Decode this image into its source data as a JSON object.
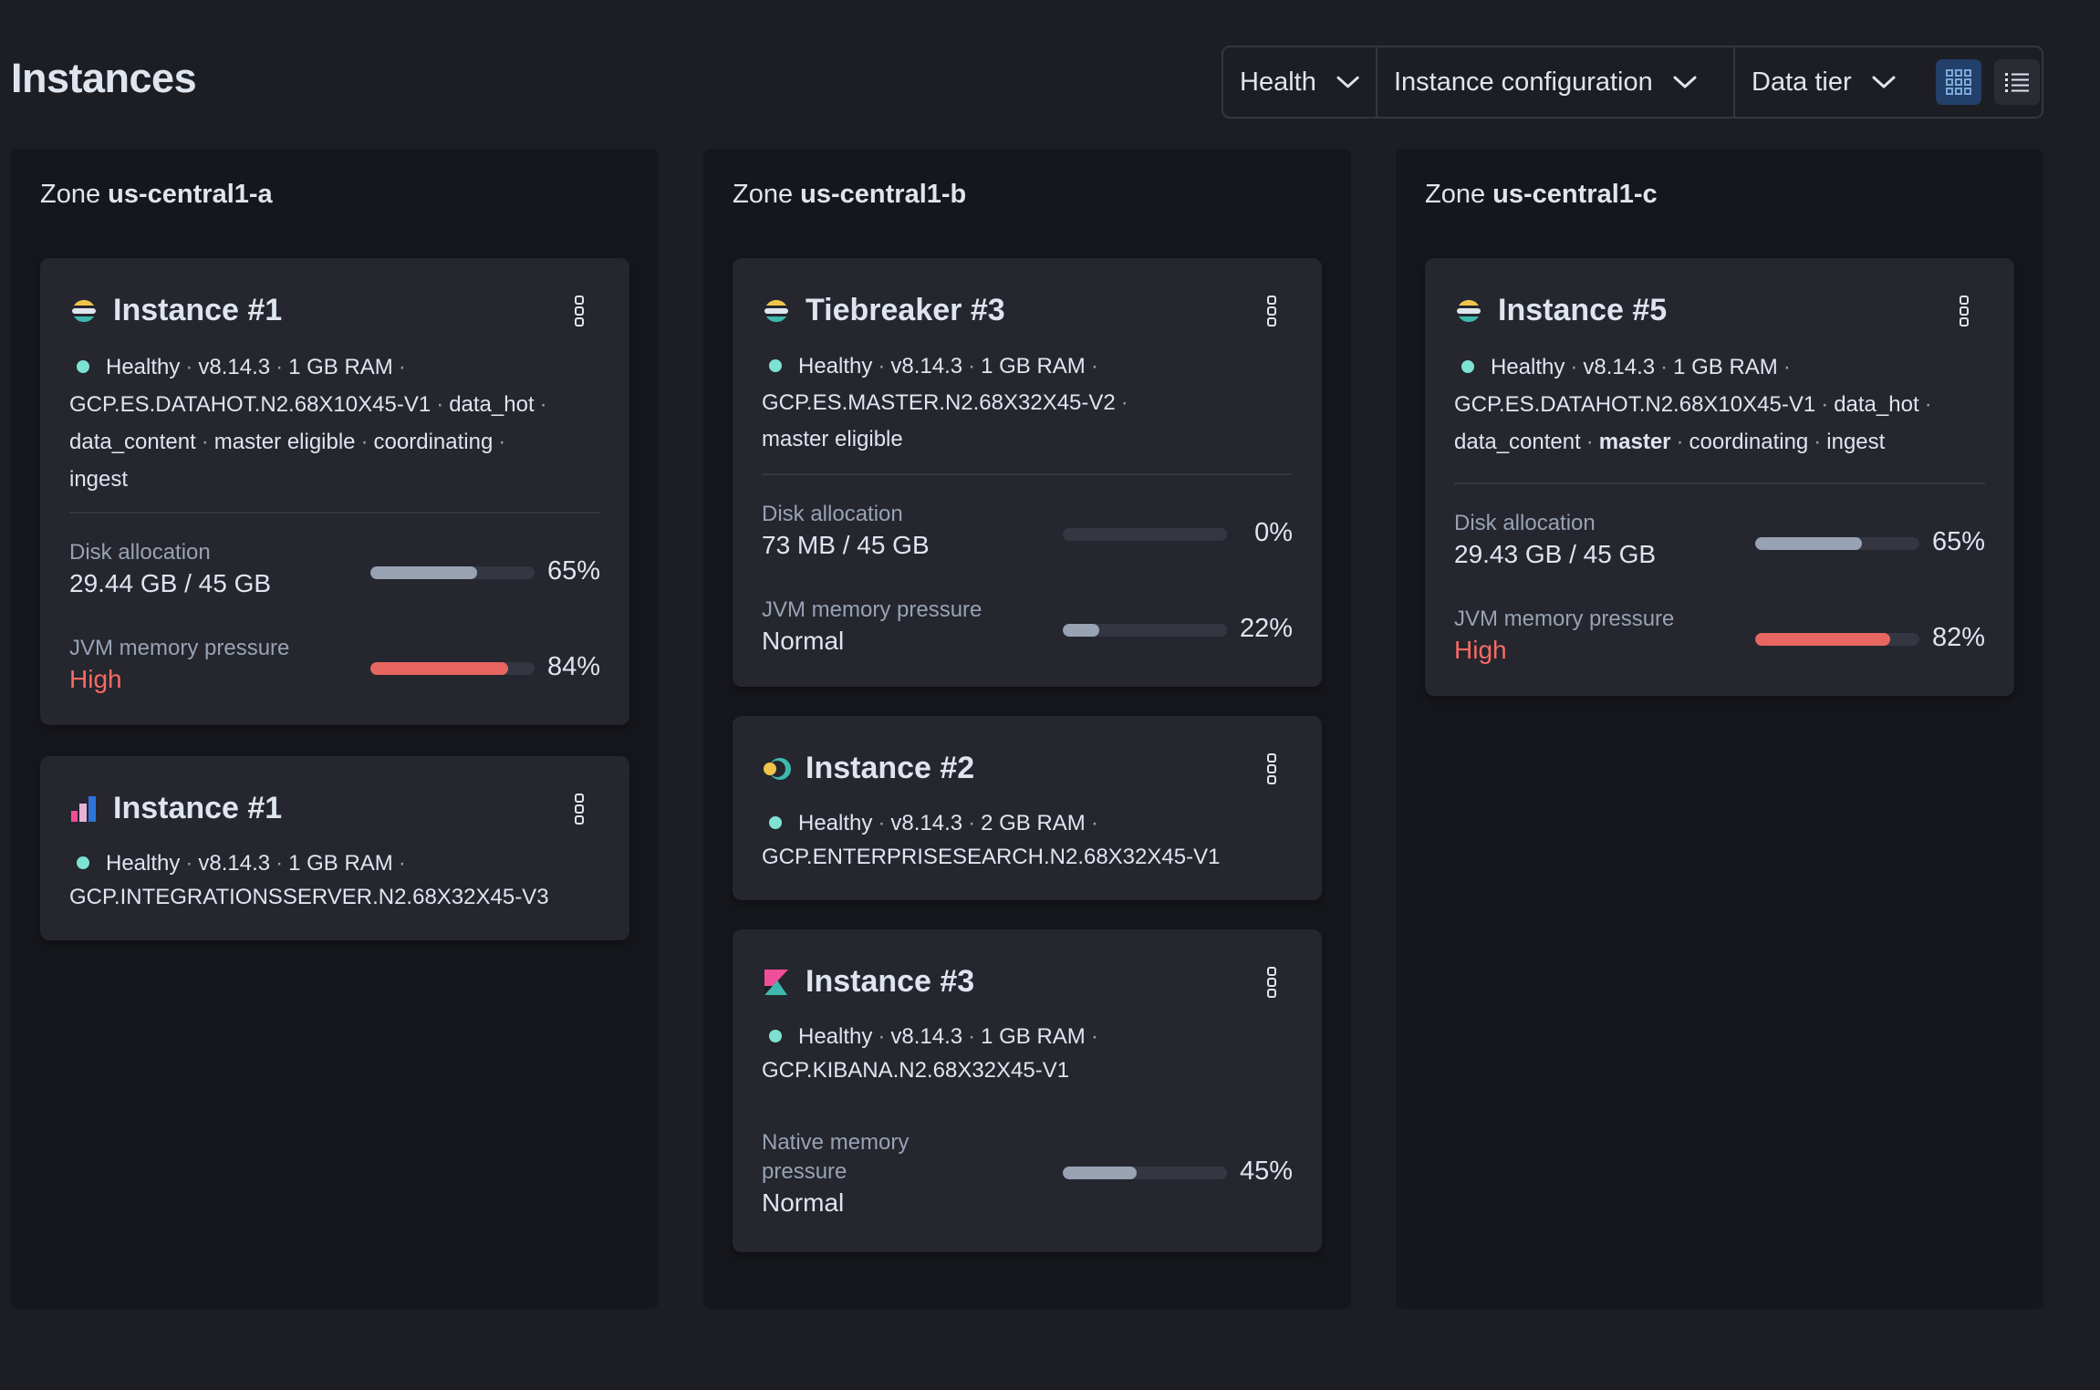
{
  "page": {
    "title": "Instances"
  },
  "filters": {
    "health": "Health",
    "instance_configuration": "Instance configuration",
    "data_tier": "Data tier"
  },
  "view_toggle": {
    "active": "grid",
    "options": [
      "grid-view-icon",
      "list-view-icon"
    ]
  },
  "colors": {
    "healthy": "#7de2d1",
    "high": "#f86b63",
    "accent": "#23406a"
  },
  "zones": [
    {
      "prefix": "Zone",
      "name": "us-central1-a",
      "cards": [
        {
          "icon": "elasticsearch-icon",
          "title": "Instance #1",
          "status": "Healthy",
          "version": "v8.14.3",
          "ram": "1 GB RAM",
          "config": "GCP.ES.DATAHOT.N2.68X10X45-V1",
          "roles": [
            "data_hot",
            "data_content",
            "master eligible",
            "coordinating",
            "ingest"
          ],
          "metrics": [
            {
              "label": "Disk allocation",
              "value": "29.44 GB / 45 GB",
              "percent": "65%",
              "fraction": 0.65
            },
            {
              "label": "JVM memory pressure",
              "value": "High",
              "percent": "84%",
              "fraction": 0.84
            }
          ]
        },
        {
          "icon": "integrations-server-icon",
          "title": "Instance #1",
          "status": "Healthy",
          "version": "v8.14.3",
          "ram": "1 GB RAM",
          "config": "GCP.INTEGRATIONSSERVER.N2.68X32X45-V3"
        }
      ]
    },
    {
      "prefix": "Zone",
      "name": "us-central1-b",
      "cards": [
        {
          "icon": "elasticsearch-icon",
          "title": "Tiebreaker #3",
          "status": "Healthy",
          "version": "v8.14.3",
          "ram": "1 GB RAM",
          "config": "GCP.ES.MASTER.N2.68X32X45-V2",
          "roles": [
            "master eligible"
          ],
          "metrics": [
            {
              "label": "Disk allocation",
              "value": "73 MB / 45 GB",
              "percent": "0%",
              "fraction": 0.0
            },
            {
              "label": "JVM memory pressure",
              "value": "Normal",
              "percent": "22%",
              "fraction": 0.22
            }
          ]
        },
        {
          "icon": "enterprise-search-icon",
          "title": "Instance #2",
          "status": "Healthy",
          "version": "v8.14.3",
          "ram": "2 GB RAM",
          "config": "GCP.ENTERPRISESEARCH.N2.68X32X45-V1"
        },
        {
          "icon": "kibana-icon",
          "title": "Instance #3",
          "status": "Healthy",
          "version": "v8.14.3",
          "ram": "1 GB RAM",
          "config": "GCP.KIBANA.N2.68X32X45-V1",
          "metrics": [
            {
              "label_line1": "Native memory",
              "label_line2": "pressure",
              "value": "Normal",
              "percent": "45%",
              "fraction": 0.45
            }
          ]
        }
      ]
    },
    {
      "prefix": "Zone",
      "name": "us-central1-c",
      "cards": [
        {
          "icon": "elasticsearch-icon",
          "title": "Instance #5",
          "status": "Healthy",
          "version": "v8.14.3",
          "ram": "1 GB RAM",
          "config": "GCP.ES.DATAHOT.N2.68X10X45-V1",
          "roles": [
            "data_hot",
            "data_content",
            "master",
            "coordinating",
            "ingest"
          ],
          "metrics": [
            {
              "label": "Disk allocation",
              "value": "29.43 GB / 45 GB",
              "percent": "65%",
              "fraction": 0.65
            },
            {
              "label": "JVM memory pressure",
              "value": "High",
              "percent": "82%",
              "fraction": 0.82
            }
          ]
        }
      ]
    }
  ]
}
